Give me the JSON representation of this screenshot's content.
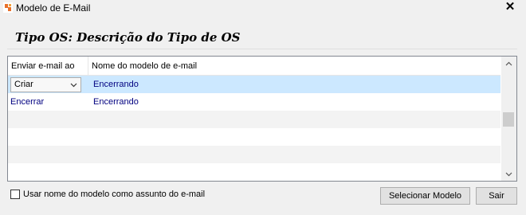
{
  "window": {
    "title": "Modelo de E-Mail",
    "close_glyph": "✕"
  },
  "header": {
    "title": "Tipo OS: Descrição do Tipo de OS"
  },
  "grid": {
    "columns": [
      "Enviar e-mail ao",
      "Nome do modelo de e-mail"
    ],
    "rows": [
      {
        "send_on": "Criar",
        "template": "Encerrando",
        "editing": true
      },
      {
        "send_on": "Encerrar",
        "template": "Encerrando",
        "editing": false
      }
    ]
  },
  "options": {
    "use_name_as_subject_label": "Usar nome do modelo como assunto do e-mail",
    "use_name_as_subject_checked": false
  },
  "buttons": {
    "select_label": "Selecionar Modelo",
    "exit_label": "Sair"
  },
  "colors": {
    "selection": "#cce8ff",
    "link_text": "#000080",
    "app_icon": "#e8702a"
  }
}
